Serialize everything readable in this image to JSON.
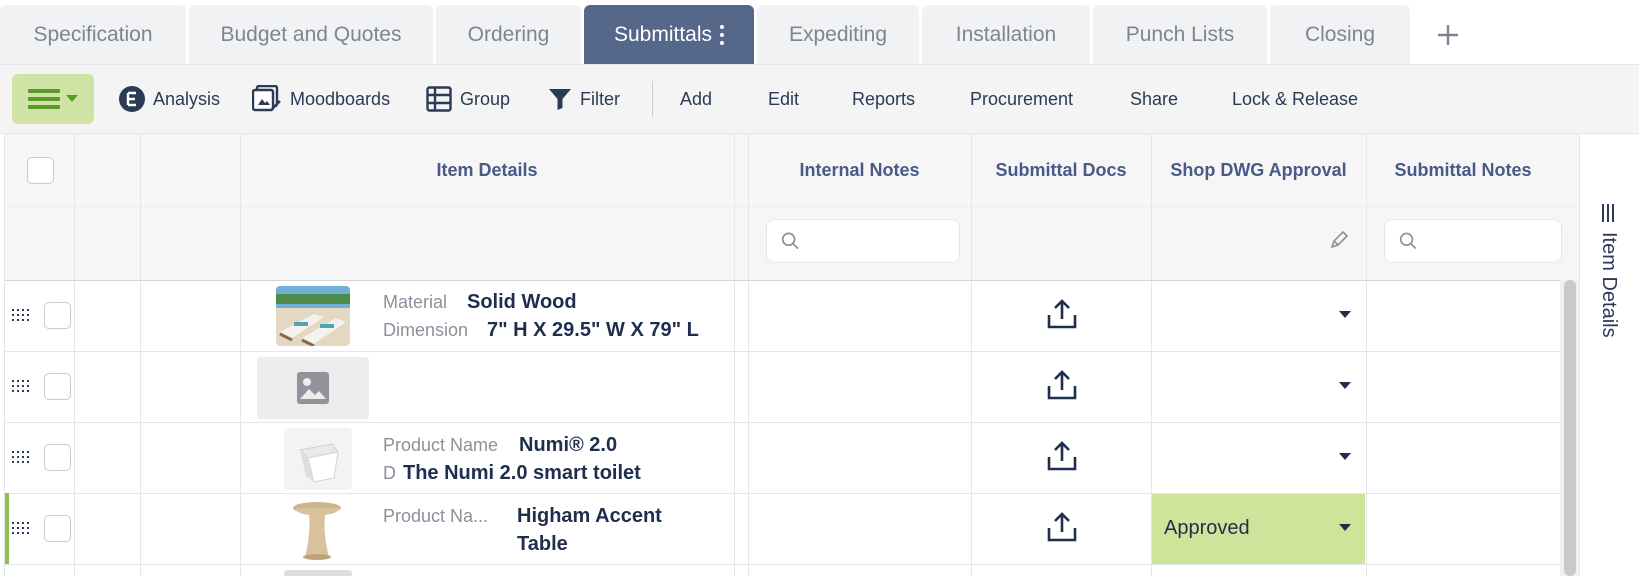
{
  "tabs": [
    {
      "label": "Specification",
      "active": false
    },
    {
      "label": "Budget and Quotes",
      "active": false
    },
    {
      "label": "Ordering",
      "active": false
    },
    {
      "label": "Submittals",
      "active": true
    },
    {
      "label": "Expediting",
      "active": false
    },
    {
      "label": "Installation",
      "active": false
    },
    {
      "label": "Punch Lists",
      "active": false
    },
    {
      "label": "Closing",
      "active": false
    }
  ],
  "add_tab_icon": "plus-icon",
  "toolbar": {
    "analysis": "Analysis",
    "moodboards": "Moodboards",
    "group": "Group",
    "filter": "Filter",
    "add": "Add",
    "edit": "Edit",
    "reports": "Reports",
    "procurement": "Procurement",
    "share": "Share",
    "lock_release": "Lock & Release"
  },
  "columns": {
    "item_details": "Item Details",
    "internal_notes": "Internal Notes",
    "submittal_docs": "Submittal Docs",
    "shop_dwg_approval": "Shop DWG Approval",
    "submittal_notes": "Submittal Notes"
  },
  "filters": {
    "internal_notes_placeholder": "",
    "submittal_notes_placeholder": ""
  },
  "rows": [
    {
      "label1": "Material",
      "value1": "Solid Wood",
      "label2": "Dimension",
      "value2": "7\" H X 29.5\" W X 79\" L",
      "approval": ""
    },
    {
      "label1": "",
      "value1": "",
      "label2": "",
      "value2": "",
      "approval": ""
    },
    {
      "label1": "Product Name",
      "value1": "Numi® 2.0",
      "label2": "D",
      "value2": "The Numi 2.0 smart toilet",
      "approval": ""
    },
    {
      "label1": "Product Na...",
      "value1": "Higham Accent",
      "label2": "",
      "value2": "Table",
      "approval": "Approved"
    }
  ],
  "side_panel": {
    "label": "Item Details"
  },
  "colors": {
    "active_tab": "#56688a",
    "menu_button": "#cfe3a5",
    "approved": "#cfe49b",
    "row_accent": "#8dbf4a"
  }
}
